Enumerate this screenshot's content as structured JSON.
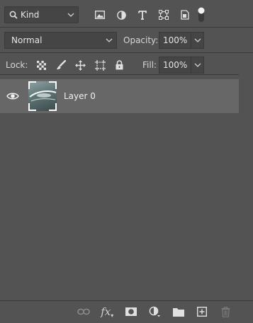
{
  "filter": {
    "kind_label": "Kind",
    "icons": [
      "image-filter-icon",
      "adjustment-filter-icon",
      "type-filter-icon",
      "shape-filter-icon",
      "smart-object-filter-icon"
    ]
  },
  "blend": {
    "mode": "Normal"
  },
  "opacity": {
    "label": "Opacity:",
    "value": "100%"
  },
  "lock": {
    "label": "Lock:",
    "icons": [
      "lock-transparent-pixels-icon",
      "lock-image-pixels-icon",
      "lock-position-icon",
      "lock-artboard-icon",
      "lock-all-icon"
    ]
  },
  "fill": {
    "label": "Fill:",
    "value": "100%"
  },
  "layers": [
    {
      "name": "Layer 0",
      "visible": true,
      "selected": true
    }
  ],
  "bottom_toolbar": {
    "icons": [
      "link-layers-icon",
      "layer-style-fx-icon",
      "add-mask-icon",
      "adjustment-layer-icon",
      "new-group-folder-icon",
      "new-layer-icon",
      "delete-layer-trash-icon"
    ],
    "fx_label": "fx"
  },
  "colors": {
    "panel_bg": "#535353",
    "selected_row": "#676767",
    "field_bg": "#454545"
  }
}
